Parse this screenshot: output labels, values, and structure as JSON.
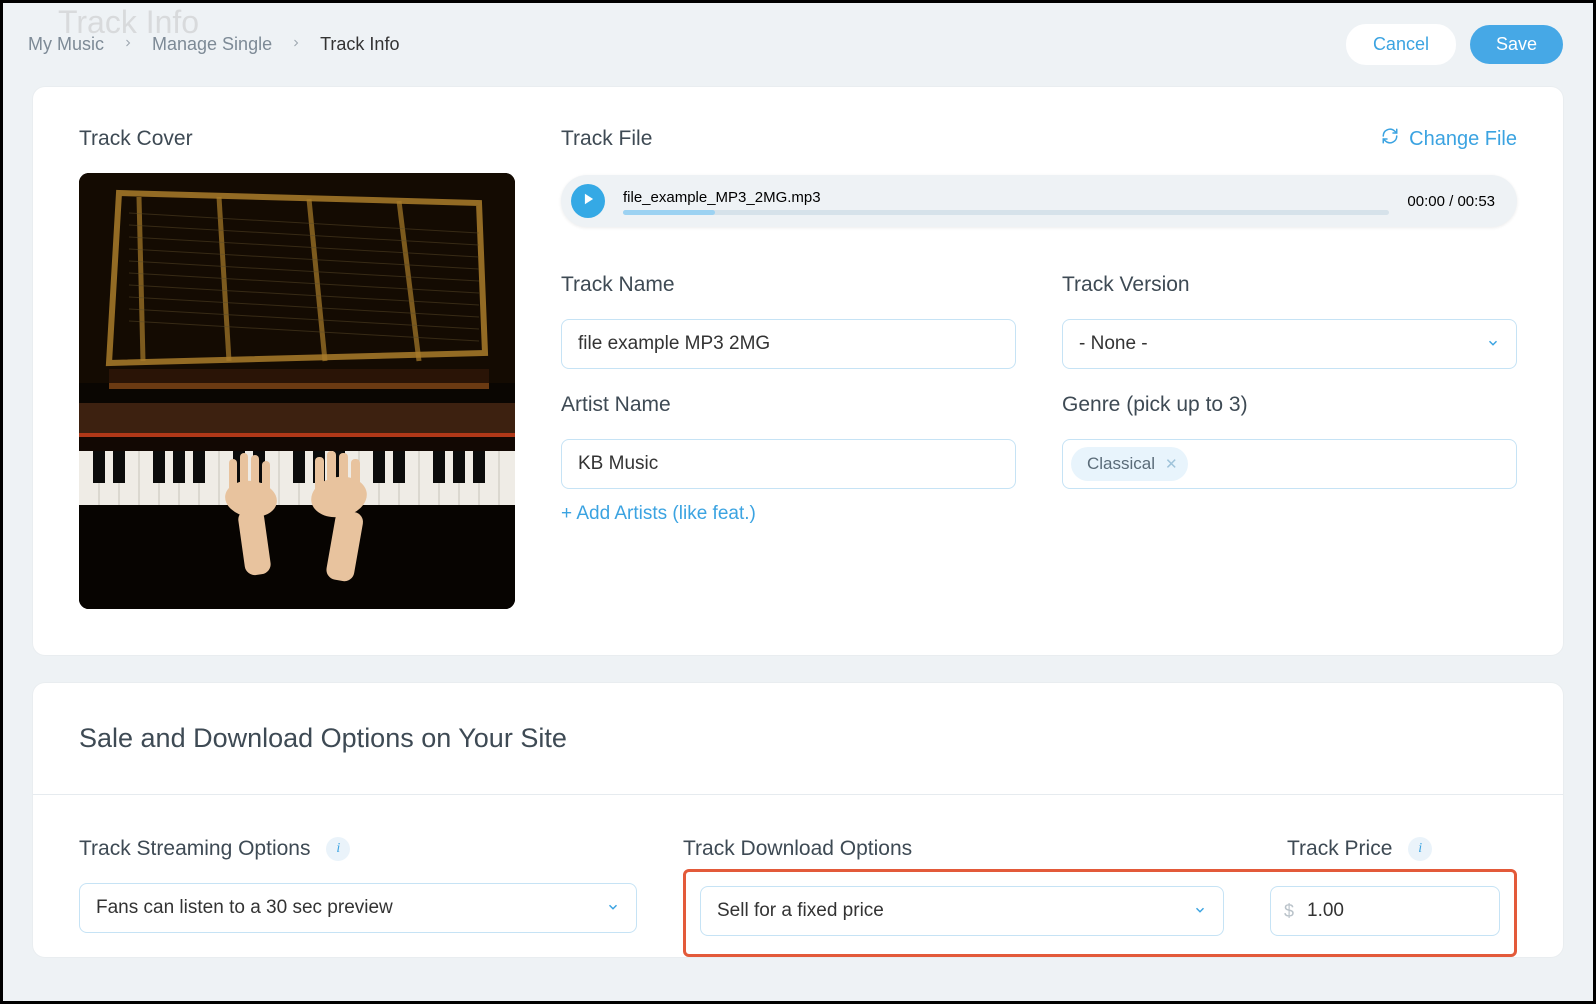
{
  "ghost_title": "Track Info",
  "breadcrumbs": {
    "items": [
      "My Music",
      "Manage Single"
    ],
    "current": "Track Info"
  },
  "actions": {
    "cancel": "Cancel",
    "save": "Save"
  },
  "cover": {
    "label": "Track Cover"
  },
  "file": {
    "label": "Track File",
    "change": "Change File",
    "filename": "file_example_MP3_2MG.mp3",
    "time": "00:00 / 00:53"
  },
  "fields": {
    "track_name": {
      "label": "Track Name",
      "value": "file example MP3 2MG"
    },
    "track_version": {
      "label": "Track Version",
      "selected": "- None -"
    },
    "artist_name": {
      "label": "Artist Name",
      "value": "KB Music"
    },
    "add_artists": "+ Add Artists (like feat.)",
    "genre": {
      "label": "Genre (pick up to 3)",
      "tags": [
        "Classical"
      ]
    }
  },
  "sale": {
    "title": "Sale and Download Options on Your Site",
    "streaming": {
      "label": "Track Streaming Options",
      "selected": "Fans can listen to a 30 sec preview"
    },
    "download": {
      "label": "Track Download Options",
      "selected": "Sell for a fixed price"
    },
    "price": {
      "label": "Track Price",
      "currency": "$",
      "value": "1.00"
    }
  }
}
